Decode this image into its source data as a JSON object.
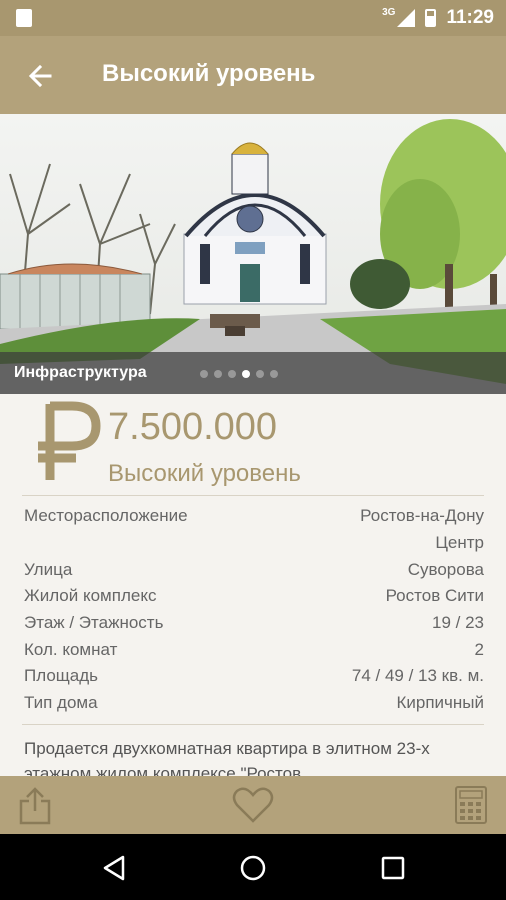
{
  "status_bar": {
    "time": "11:29",
    "network": "3G"
  },
  "app_bar": {
    "title": "Высокий уровень"
  },
  "gallery": {
    "caption": "Инфраструктура",
    "total_dots": 6,
    "active_dot": 4
  },
  "listing": {
    "currency_symbol": "₽",
    "price": "7.500.000",
    "level": "Высокий уровень",
    "specs": [
      {
        "label": "Месторасположение",
        "value": "Ростов-на-Дону"
      },
      {
        "label": "",
        "value": "Центр"
      },
      {
        "label": "Улица",
        "value": "Суворова"
      },
      {
        "label": "Жилой комплекс",
        "value": "Ростов Сити"
      },
      {
        "label": "Этаж / Этажность",
        "value": "19 / 23"
      },
      {
        "label": "Кол. комнат",
        "value": "2"
      },
      {
        "label": "Площадь",
        "value": "74 / 49 / 13 кв. м."
      },
      {
        "label": "Тип дома",
        "value": "Кирпичный"
      }
    ],
    "description": "Продается двухкомнатная квартира в элитном 23-х этажном жилом комплексе \"Ростов"
  },
  "colors": {
    "accent": "#b3a27b",
    "accent_text": "#a8976f",
    "status_bar": "#a8976f"
  },
  "icons": {
    "back": "arrow-left-icon",
    "share": "share-icon",
    "favorite": "heart-icon",
    "calculator": "calculator-icon",
    "nav_back": "triangle-back-icon",
    "nav_home": "circle-home-icon",
    "nav_recents": "square-recents-icon"
  }
}
